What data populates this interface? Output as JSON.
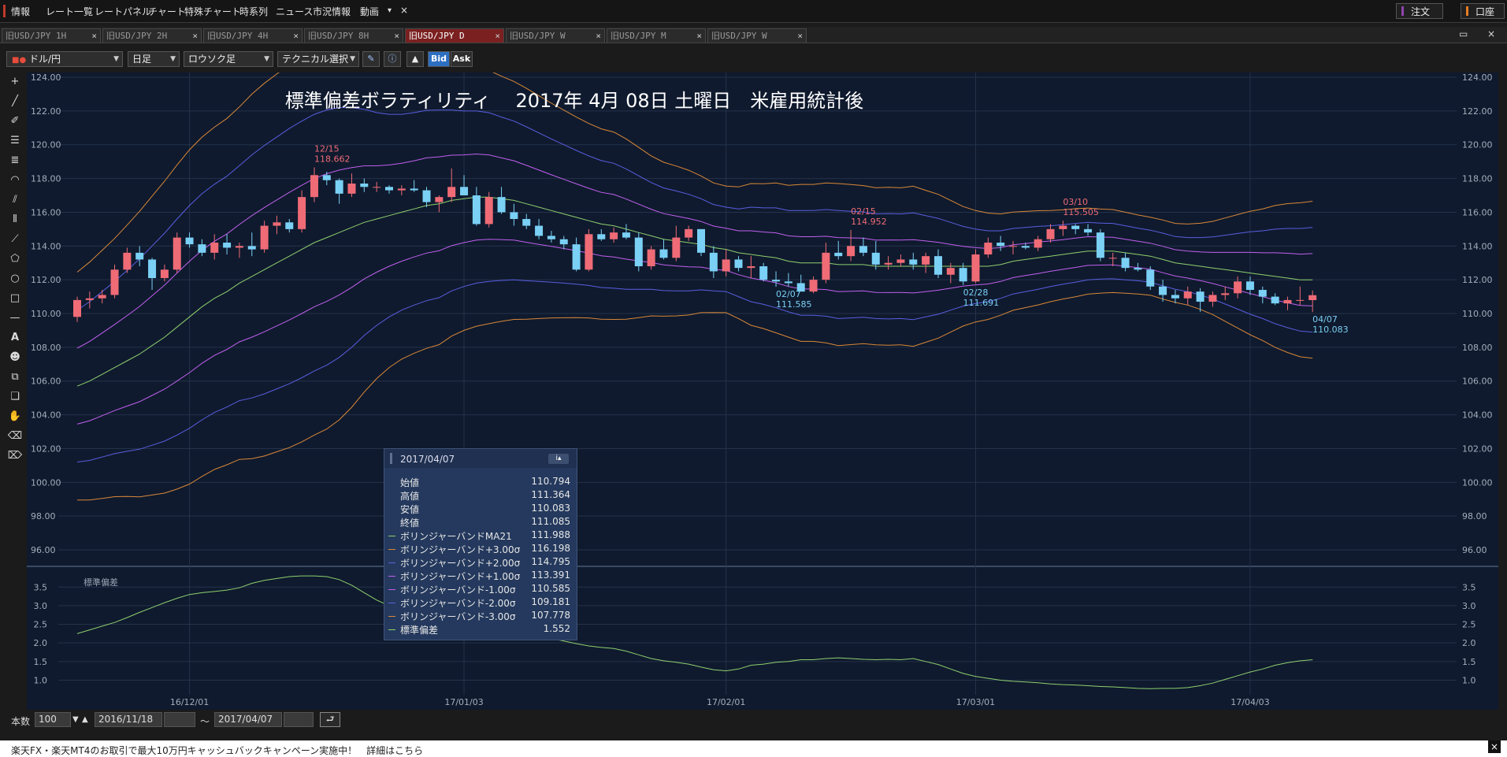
{
  "menubar": {
    "items": [
      "情報",
      "レート一覧",
      "レートパネル",
      "チャート",
      "特殊チャート",
      "時系列",
      "ニュース",
      "市況情報",
      "動画"
    ],
    "dropdown": "▾",
    "close": "×",
    "order_button": "注文",
    "account_button": "口座"
  },
  "tabs": [
    {
      "label": "旧USD/JPY 1H",
      "active": false
    },
    {
      "label": "旧USD/JPY 2H",
      "active": false
    },
    {
      "label": "旧USD/JPY 4H",
      "active": false
    },
    {
      "label": "旧USD/JPY 8H",
      "active": false
    },
    {
      "label": "旧USD/JPY D",
      "active": true
    },
    {
      "label": "旧USD/JPY W",
      "active": false
    },
    {
      "label": "旧USD/JPY M",
      "active": false
    },
    {
      "label": "旧USD/JPY W",
      "active": false
    }
  ],
  "toolbar": {
    "pair": "ドル/円",
    "timeframe": "日足",
    "chart_type": "ロウソク足",
    "technical": "テクニカル選択",
    "bid": "Bid",
    "ask": "Ask"
  },
  "colors": {
    "up": "#ef6b76",
    "down": "#7ad0f5",
    "ma": "#8fd06e",
    "sigma1": "#c060ee",
    "sigma2": "#5a5ee0",
    "sigma3": "#d98838",
    "bg": "#0f1a2e"
  },
  "chart_data": {
    "type": "candlestick",
    "title": "標準偏差ボラティリティ　 2017年 4月 08日 土曜日　米雇用統計後",
    "price_axis": {
      "ticks": [
        "124.00",
        "122.00",
        "120.00",
        "118.00",
        "116.00",
        "114.00",
        "112.00",
        "110.00",
        "108.00",
        "106.00",
        "104.00",
        "102.00",
        "100.00",
        "98.00",
        "96.00"
      ],
      "range": [
        95,
        124
      ]
    },
    "date_ticks": [
      "16/12/01",
      "17/01/03",
      "17/02/01",
      "17/03/01",
      "17/04/03"
    ],
    "candles": [
      {
        "d": "11/18",
        "o": 109.8,
        "h": 111.0,
        "l": 109.5,
        "c": 110.8
      },
      {
        "d": "11/21",
        "o": 110.8,
        "h": 111.3,
        "l": 110.3,
        "c": 110.9
      },
      {
        "d": "11/22",
        "o": 110.9,
        "h": 111.4,
        "l": 110.6,
        "c": 111.1
      },
      {
        "d": "11/23",
        "o": 111.1,
        "h": 112.9,
        "l": 110.9,
        "c": 112.6
      },
      {
        "d": "11/24",
        "o": 112.6,
        "h": 113.9,
        "l": 112.4,
        "c": 113.6
      },
      {
        "d": "11/25",
        "o": 113.6,
        "h": 114.0,
        "l": 112.8,
        "c": 113.2
      },
      {
        "d": "11/28",
        "o": 113.2,
        "h": 113.3,
        "l": 111.4,
        "c": 112.1
      },
      {
        "d": "11/29",
        "o": 112.1,
        "h": 112.9,
        "l": 111.9,
        "c": 112.6
      },
      {
        "d": "11/30",
        "o": 112.6,
        "h": 114.8,
        "l": 112.4,
        "c": 114.5
      },
      {
        "d": "12/01",
        "o": 114.5,
        "h": 114.8,
        "l": 113.9,
        "c": 114.1
      },
      {
        "d": "12/02",
        "o": 114.1,
        "h": 114.4,
        "l": 113.4,
        "c": 113.6
      },
      {
        "d": "12/05",
        "o": 113.6,
        "h": 114.7,
        "l": 113.2,
        "c": 114.2
      },
      {
        "d": "12/06",
        "o": 114.2,
        "h": 114.7,
        "l": 113.5,
        "c": 113.9
      },
      {
        "d": "12/07",
        "o": 113.9,
        "h": 114.2,
        "l": 113.3,
        "c": 114.0
      },
      {
        "d": "12/08",
        "o": 114.0,
        "h": 114.8,
        "l": 113.4,
        "c": 113.8
      },
      {
        "d": "12/09",
        "o": 113.8,
        "h": 115.5,
        "l": 113.6,
        "c": 115.2
      },
      {
        "d": "12/12",
        "o": 115.2,
        "h": 115.8,
        "l": 114.7,
        "c": 115.4
      },
      {
        "d": "12/13",
        "o": 115.4,
        "h": 115.6,
        "l": 114.8,
        "c": 115.0
      },
      {
        "d": "12/14",
        "o": 115.0,
        "h": 117.3,
        "l": 114.8,
        "c": 116.9
      },
      {
        "d": "12/15",
        "o": 116.9,
        "h": 118.662,
        "l": 116.6,
        "c": 118.2
      },
      {
        "d": "12/16",
        "o": 118.2,
        "h": 118.4,
        "l": 117.6,
        "c": 117.9
      },
      {
        "d": "12/19",
        "o": 117.9,
        "h": 118.0,
        "l": 116.5,
        "c": 117.1
      },
      {
        "d": "12/20",
        "o": 117.1,
        "h": 118.3,
        "l": 116.9,
        "c": 117.7
      },
      {
        "d": "12/21",
        "o": 117.7,
        "h": 118.0,
        "l": 117.2,
        "c": 117.5
      },
      {
        "d": "12/22",
        "o": 117.5,
        "h": 117.8,
        "l": 117.2,
        "c": 117.5
      },
      {
        "d": "12/23",
        "o": 117.5,
        "h": 117.6,
        "l": 117.1,
        "c": 117.3
      },
      {
        "d": "12/26",
        "o": 117.3,
        "h": 117.6,
        "l": 117.0,
        "c": 117.4
      },
      {
        "d": "12/27",
        "o": 117.4,
        "h": 117.9,
        "l": 117.2,
        "c": 117.3
      },
      {
        "d": "12/28",
        "o": 117.3,
        "h": 117.5,
        "l": 116.3,
        "c": 116.6
      },
      {
        "d": "12/29",
        "o": 116.6,
        "h": 117.0,
        "l": 116.0,
        "c": 116.9
      },
      {
        "d": "12/30",
        "o": 116.9,
        "h": 118.6,
        "l": 116.6,
        "c": 117.5
      },
      {
        "d": "01/03",
        "o": 117.5,
        "h": 118.2,
        "l": 117.1,
        "c": 117.0
      },
      {
        "d": "01/04",
        "o": 117.0,
        "h": 117.5,
        "l": 115.2,
        "c": 115.3
      },
      {
        "d": "01/05",
        "o": 115.3,
        "h": 117.2,
        "l": 115.1,
        "c": 116.9
      },
      {
        "d": "01/06",
        "o": 116.9,
        "h": 117.5,
        "l": 115.9,
        "c": 116.0
      },
      {
        "d": "01/09",
        "o": 116.0,
        "h": 116.5,
        "l": 115.2,
        "c": 115.6
      },
      {
        "d": "01/10",
        "o": 115.6,
        "h": 115.9,
        "l": 115.0,
        "c": 115.2
      },
      {
        "d": "01/11",
        "o": 115.2,
        "h": 115.6,
        "l": 114.4,
        "c": 114.6
      },
      {
        "d": "01/12",
        "o": 114.6,
        "h": 114.9,
        "l": 114.2,
        "c": 114.4
      },
      {
        "d": "01/13",
        "o": 114.4,
        "h": 114.6,
        "l": 113.8,
        "c": 114.1
      },
      {
        "d": "01/16",
        "o": 114.1,
        "h": 114.5,
        "l": 112.5,
        "c": 112.6
      },
      {
        "d": "01/17",
        "o": 112.6,
        "h": 115.0,
        "l": 112.5,
        "c": 114.7
      },
      {
        "d": "01/18",
        "o": 114.7,
        "h": 115.0,
        "l": 114.3,
        "c": 114.4
      },
      {
        "d": "01/19",
        "o": 114.4,
        "h": 115.1,
        "l": 114.2,
        "c": 114.8
      },
      {
        "d": "01/20",
        "o": 114.8,
        "h": 115.3,
        "l": 114.4,
        "c": 114.5
      },
      {
        "d": "01/23",
        "o": 114.5,
        "h": 114.8,
        "l": 112.5,
        "c": 112.8
      },
      {
        "d": "01/24",
        "o": 112.8,
        "h": 114.0,
        "l": 112.6,
        "c": 113.8
      },
      {
        "d": "01/25",
        "o": 113.8,
        "h": 114.4,
        "l": 113.2,
        "c": 113.3
      },
      {
        "d": "01/26",
        "o": 113.3,
        "h": 115.2,
        "l": 113.1,
        "c": 114.5
      },
      {
        "d": "01/27",
        "o": 114.5,
        "h": 115.2,
        "l": 114.3,
        "c": 115.0
      },
      {
        "d": "01/30",
        "o": 115.0,
        "h": 115.0,
        "l": 113.4,
        "c": 113.6
      },
      {
        "d": "01/31",
        "o": 113.6,
        "h": 114.0,
        "l": 112.1,
        "c": 112.5
      },
      {
        "d": "02/01",
        "o": 112.5,
        "h": 113.8,
        "l": 112.2,
        "c": 113.2
      },
      {
        "d": "02/02",
        "o": 113.2,
        "h": 113.4,
        "l": 112.5,
        "c": 112.7
      },
      {
        "d": "02/03",
        "o": 112.7,
        "h": 113.4,
        "l": 112.1,
        "c": 112.8
      },
      {
        "d": "02/06",
        "o": 112.8,
        "h": 113.0,
        "l": 111.9,
        "c": 112.0
      },
      {
        "d": "02/07",
        "o": 112.0,
        "h": 112.5,
        "l": 111.585,
        "c": 111.9
      },
      {
        "d": "02/08",
        "o": 111.9,
        "h": 112.4,
        "l": 111.6,
        "c": 111.8
      },
      {
        "d": "02/09",
        "o": 111.8,
        "h": 112.3,
        "l": 111.5,
        "c": 111.3
      },
      {
        "d": "02/10",
        "o": 111.3,
        "h": 112.2,
        "l": 111.2,
        "c": 112.0
      },
      {
        "d": "02/13",
        "o": 112.0,
        "h": 114.2,
        "l": 111.8,
        "c": 113.6
      },
      {
        "d": "02/14",
        "o": 113.6,
        "h": 114.3,
        "l": 113.2,
        "c": 113.4
      },
      {
        "d": "02/15",
        "o": 113.4,
        "h": 114.952,
        "l": 113.1,
        "c": 114.0
      },
      {
        "d": "02/16",
        "o": 114.0,
        "h": 114.5,
        "l": 113.4,
        "c": 113.6
      },
      {
        "d": "02/17",
        "o": 113.6,
        "h": 114.3,
        "l": 112.6,
        "c": 112.9
      },
      {
        "d": "02/20",
        "o": 112.9,
        "h": 113.4,
        "l": 112.6,
        "c": 113.0
      },
      {
        "d": "02/21",
        "o": 113.0,
        "h": 113.5,
        "l": 112.8,
        "c": 113.2
      },
      {
        "d": "02/22",
        "o": 113.2,
        "h": 113.6,
        "l": 112.6,
        "c": 112.9
      },
      {
        "d": "02/23",
        "o": 112.9,
        "h": 113.6,
        "l": 112.4,
        "c": 113.4
      },
      {
        "d": "02/24",
        "o": 113.4,
        "h": 113.8,
        "l": 112.1,
        "c": 112.3
      },
      {
        "d": "02/27",
        "o": 112.3,
        "h": 113.0,
        "l": 111.8,
        "c": 112.7
      },
      {
        "d": "02/28",
        "o": 112.7,
        "h": 113.0,
        "l": 111.691,
        "c": 111.9
      },
      {
        "d": "03/01",
        "o": 111.9,
        "h": 113.8,
        "l": 111.8,
        "c": 113.5
      },
      {
        "d": "03/02",
        "o": 113.5,
        "h": 114.5,
        "l": 113.3,
        "c": 114.2
      },
      {
        "d": "03/03",
        "o": 114.2,
        "h": 114.6,
        "l": 113.7,
        "c": 114.0
      },
      {
        "d": "03/06",
        "o": 114.0,
        "h": 114.3,
        "l": 113.5,
        "c": 114.0
      },
      {
        "d": "03/07",
        "o": 114.0,
        "h": 114.2,
        "l": 113.8,
        "c": 113.9
      },
      {
        "d": "03/08",
        "o": 113.9,
        "h": 114.6,
        "l": 113.7,
        "c": 114.4
      },
      {
        "d": "03/09",
        "o": 114.4,
        "h": 115.3,
        "l": 114.2,
        "c": 115.0
      },
      {
        "d": "03/10",
        "o": 115.0,
        "h": 115.505,
        "l": 114.6,
        "c": 115.2
      },
      {
        "d": "03/13",
        "o": 115.2,
        "h": 115.3,
        "l": 114.7,
        "c": 115.0
      },
      {
        "d": "03/14",
        "o": 115.0,
        "h": 115.3,
        "l": 114.6,
        "c": 114.8
      },
      {
        "d": "03/15",
        "o": 114.8,
        "h": 115.0,
        "l": 113.1,
        "c": 113.3
      },
      {
        "d": "03/16",
        "o": 113.3,
        "h": 113.6,
        "l": 112.8,
        "c": 113.3
      },
      {
        "d": "03/17",
        "o": 113.3,
        "h": 113.6,
        "l": 112.5,
        "c": 112.7
      },
      {
        "d": "03/20",
        "o": 112.7,
        "h": 113.0,
        "l": 112.5,
        "c": 112.6
      },
      {
        "d": "03/21",
        "o": 112.6,
        "h": 112.8,
        "l": 111.4,
        "c": 111.6
      },
      {
        "d": "03/22",
        "o": 111.6,
        "h": 112.0,
        "l": 110.7,
        "c": 111.1
      },
      {
        "d": "03/23",
        "o": 111.1,
        "h": 111.4,
        "l": 110.6,
        "c": 110.9
      },
      {
        "d": "03/24",
        "o": 110.9,
        "h": 111.6,
        "l": 110.5,
        "c": 111.3
      },
      {
        "d": "03/27",
        "o": 111.3,
        "h": 111.5,
        "l": 110.1,
        "c": 110.7
      },
      {
        "d": "03/28",
        "o": 110.7,
        "h": 111.3,
        "l": 110.4,
        "c": 111.1
      },
      {
        "d": "03/29",
        "o": 111.1,
        "h": 111.6,
        "l": 110.8,
        "c": 111.2
      },
      {
        "d": "03/30",
        "o": 111.2,
        "h": 112.2,
        "l": 110.9,
        "c": 111.9
      },
      {
        "d": "03/31",
        "o": 111.9,
        "h": 112.2,
        "l": 111.1,
        "c": 111.4
      },
      {
        "d": "04/03",
        "o": 111.4,
        "h": 111.6,
        "l": 110.6,
        "c": 111.0
      },
      {
        "d": "04/04",
        "o": 111.0,
        "h": 111.2,
        "l": 110.5,
        "c": 110.6
      },
      {
        "d": "04/05",
        "o": 110.6,
        "h": 111.0,
        "l": 110.2,
        "c": 110.8
      },
      {
        "d": "04/06",
        "o": 110.8,
        "h": 111.6,
        "l": 110.5,
        "c": 110.8
      },
      {
        "d": "04/07",
        "o": 110.794,
        "h": 111.364,
        "l": 110.083,
        "c": 111.085
      }
    ],
    "annotations": [
      {
        "date": "12/15",
        "value": "118.662",
        "side": "high"
      },
      {
        "date": "02/15",
        "value": "114.952",
        "side": "high"
      },
      {
        "date": "03/10",
        "value": "115.505",
        "side": "high"
      },
      {
        "date": "02/07",
        "value": "111.585",
        "side": "low"
      },
      {
        "date": "02/28",
        "value": "111.691",
        "side": "low"
      },
      {
        "date": "04/07",
        "value": "110.083",
        "side": "low"
      }
    ],
    "bands": {
      "ma": [
        105.7,
        106.0,
        106.4,
        106.8,
        107.2,
        107.6,
        108.1,
        108.6,
        109.2,
        109.8,
        110.4,
        110.9,
        111.3,
        111.8,
        112.2,
        112.6,
        113.0,
        113.4,
        113.8,
        114.2,
        114.5,
        114.8,
        115.1,
        115.4,
        115.6,
        115.8,
        116.0,
        116.2,
        116.4,
        116.5,
        116.7,
        116.8,
        116.9,
        116.9,
        116.8,
        116.7,
        116.5,
        116.3,
        116.1,
        115.9,
        115.7,
        115.5,
        115.3,
        115.2,
        115.0,
        114.8,
        114.6,
        114.4,
        114.3,
        114.2,
        114.1,
        113.9,
        113.8,
        113.6,
        113.5,
        113.4,
        113.3,
        113.1,
        113.0,
        113.0,
        113.0,
        112.9,
        112.9,
        112.9,
        112.8,
        112.8,
        112.8,
        112.8,
        112.8,
        112.8,
        112.8,
        112.8,
        112.8,
        112.8,
        112.9,
        113.1,
        113.2,
        113.3,
        113.4,
        113.5,
        113.6,
        113.7,
        113.7,
        113.7,
        113.6,
        113.5,
        113.4,
        113.2,
        113.0,
        112.9,
        112.8,
        112.7,
        112.6,
        112.5,
        112.4,
        112.3,
        112.2,
        112.1,
        112.0,
        112.0
      ],
      "sd": [
        2.25,
        2.35,
        2.45,
        2.55,
        2.68,
        2.82,
        2.95,
        3.08,
        3.2,
        3.3,
        3.35,
        3.38,
        3.42,
        3.48,
        3.6,
        3.68,
        3.73,
        3.78,
        3.8,
        3.8,
        3.78,
        3.7,
        3.55,
        3.35,
        3.15,
        3.0,
        2.9,
        2.85,
        2.82,
        2.78,
        2.68,
        2.6,
        2.55,
        2.5,
        2.42,
        2.35,
        2.28,
        2.2,
        2.12,
        2.05,
        1.98,
        1.92,
        1.88,
        1.85,
        1.78,
        1.68,
        1.58,
        1.52,
        1.48,
        1.43,
        1.35,
        1.28,
        1.25,
        1.3,
        1.4,
        1.43,
        1.48,
        1.5,
        1.55,
        1.55,
        1.58,
        1.6,
        1.58,
        1.56,
        1.55,
        1.56,
        1.55,
        1.58,
        1.5,
        1.42,
        1.3,
        1.18,
        1.1,
        1.05,
        1.0,
        0.97,
        0.95,
        0.93,
        0.9,
        0.88,
        0.87,
        0.85,
        0.83,
        0.82,
        0.8,
        0.78,
        0.77,
        0.78,
        0.78,
        0.8,
        0.85,
        0.92,
        1.02,
        1.12,
        1.22,
        1.3,
        1.4,
        1.47,
        1.52,
        1.55
      ]
    },
    "sub_label": "標準偏差",
    "sub_ticks": [
      "3.5",
      "3.0",
      "2.5",
      "2.0",
      "1.5",
      "1.0"
    ],
    "sub_range": [
      0.65,
      3.95
    ]
  },
  "infobox": {
    "date": "2017/04/07",
    "icon": "i▴",
    "rows": [
      {
        "label": "始値",
        "value": "110.794",
        "color": ""
      },
      {
        "label": "高値",
        "value": "111.364",
        "color": ""
      },
      {
        "label": "安値",
        "value": "110.083",
        "color": ""
      },
      {
        "label": "終値",
        "value": "111.085",
        "color": ""
      },
      {
        "label": "ボリンジャーバンドMA21",
        "value": "111.988",
        "color": "#8fd06e"
      },
      {
        "label": "ボリンジャーバンド+3.00σ",
        "value": "116.198",
        "color": "#d98838"
      },
      {
        "label": "ボリンジャーバンド+2.00σ",
        "value": "114.795",
        "color": "#5a5ee0"
      },
      {
        "label": "ボリンジャーバンド+1.00σ",
        "value": "113.391",
        "color": "#c060ee"
      },
      {
        "label": "ボリンジャーバンド-1.00σ",
        "value": "110.585",
        "color": "#c060ee"
      },
      {
        "label": "ボリンジャーバンド-2.00σ",
        "value": "109.181",
        "color": "#5a5ee0"
      },
      {
        "label": "ボリンジャーバンド-3.00σ",
        "value": "107.778",
        "color": "#d98838"
      },
      {
        "label": "標準偏差",
        "value": "1.552",
        "color": "#8fd06e"
      }
    ]
  },
  "bottombar": {
    "count_label": "本数",
    "count_value": "100",
    "start_date": "2016/11/18",
    "tilde": "〜",
    "end_date": "2017/04/07"
  },
  "news": {
    "text": "楽天FX・楽天MT4のお取引で最大10万円キャッシュバックキャンペーン実施中！　詳細はこちら",
    "close": "×"
  }
}
